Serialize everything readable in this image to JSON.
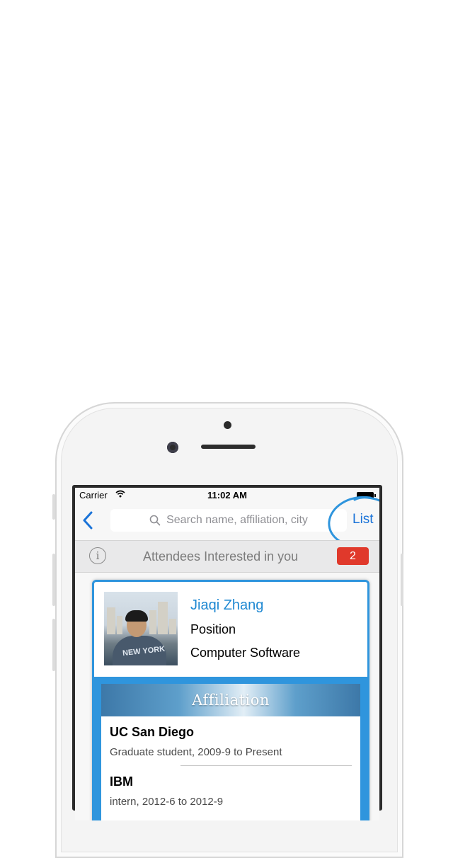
{
  "status_bar": {
    "carrier": "Carrier",
    "time": "11:02 AM"
  },
  "nav": {
    "search_placeholder": "Search name, affiliation, city",
    "list_label": "List"
  },
  "interest_bar": {
    "text": "Attendees Interested in you",
    "count": "2"
  },
  "profile": {
    "name": "Jiaqi Zhang",
    "position": "Position",
    "industry": "Computer Software",
    "shirt_text": "NEW YORK"
  },
  "affiliation": {
    "header": "Affiliation",
    "items": [
      {
        "org": "UC San Diego",
        "detail": "Graduate student, 2009-9 to Present"
      },
      {
        "org": "IBM",
        "detail": "intern, 2012-6 to 2012-9"
      }
    ]
  },
  "colors": {
    "accent": "#1a73d8",
    "card_border": "#2f95dd",
    "badge": "#e0392b"
  },
  "icons": [
    "back-chevron-icon",
    "search-icon",
    "wifi-icon",
    "battery-icon",
    "info-icon"
  ]
}
